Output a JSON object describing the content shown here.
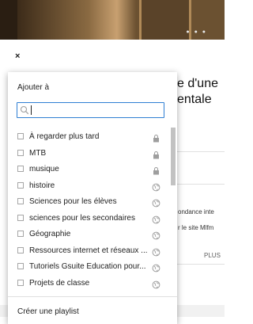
{
  "background": {
    "close_glyph": "×",
    "title_line1": "e d'une",
    "title_line2": "entale",
    "text_line1": "ondance inte",
    "text_line2": "r le site Mlfm",
    "more_label": "PLUS",
    "video_dots": "● ● ●"
  },
  "dialog": {
    "title": "Ajouter à",
    "search": {
      "value": "",
      "placeholder": ""
    },
    "playlists": [
      {
        "label": "À regarder plus tard",
        "privacy_icon": "lock-icon"
      },
      {
        "label": "MTB",
        "privacy_icon": "lock-icon"
      },
      {
        "label": "musique",
        "privacy_icon": "lock-icon"
      },
      {
        "label": "histoire",
        "privacy_icon": "globe-icon"
      },
      {
        "label": "Sciences pour les élèves",
        "privacy_icon": "globe-icon"
      },
      {
        "label": "sciences pour les secondaires",
        "privacy_icon": "globe-icon"
      },
      {
        "label": "Géographie",
        "privacy_icon": "globe-icon"
      },
      {
        "label": "Ressources internet et réseaux ...",
        "privacy_icon": "globe-icon"
      },
      {
        "label": "Tutoriels Gsuite Education pour...",
        "privacy_icon": "globe-icon"
      },
      {
        "label": "Projets de classe",
        "privacy_icon": "globe-icon"
      }
    ],
    "create_label": "Créer une playlist"
  },
  "colors": {
    "accent": "#2f7fd3",
    "icon_grey": "#9e9e9e",
    "scroll_thumb": "#c2c2c2"
  }
}
